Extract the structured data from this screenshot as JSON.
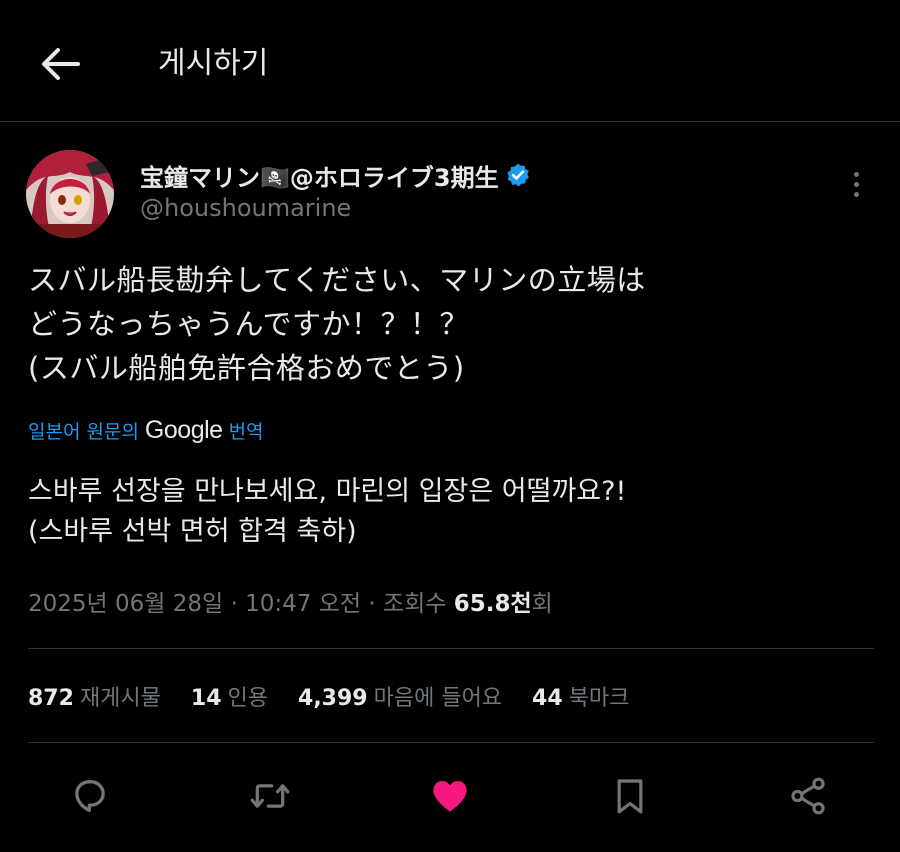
{
  "header": {
    "title": "게시하기",
    "back_icon": "arrow-left-icon"
  },
  "author": {
    "display_name": "宝鐘マリン🏴‍☠️@ホロライブ3期生",
    "handle": "@houshoumarine",
    "verified_color": "#1d9bf0"
  },
  "tweet": {
    "lines": [
      "スバル船長勘弁してください、マリンの立場は",
      "どうなっちゃうんですか！？！？",
      "(スバル船舶免許合格おめでとう)"
    ]
  },
  "translation": {
    "prefix": "일본어 원문의",
    "brand": "Google",
    "suffix": "번역",
    "lines": [
      "스바루 선장을 만나보세요, 마린의 입장은 어떨까요?!",
      "(스바루 선박 면허 합격 축하)"
    ]
  },
  "meta": {
    "datetime": "2025년 06월 28일 · 10:47 오전 · 조회수 ",
    "views": "65.8천",
    "views_suffix": "회"
  },
  "stats": {
    "reposts": {
      "count": "872",
      "label": "재게시물"
    },
    "quotes": {
      "count": "14",
      "label": "인용"
    },
    "likes": {
      "count": "4,399",
      "label": "마음에 들어요"
    },
    "bookmarks": {
      "count": "44",
      "label": "북마크"
    }
  },
  "actions": {
    "reply_icon": "reply-icon",
    "repost_icon": "repost-icon",
    "like_icon": "heart-icon",
    "like_color": "#f91880",
    "bookmark_icon": "bookmark-icon",
    "share_icon": "share-icon"
  }
}
